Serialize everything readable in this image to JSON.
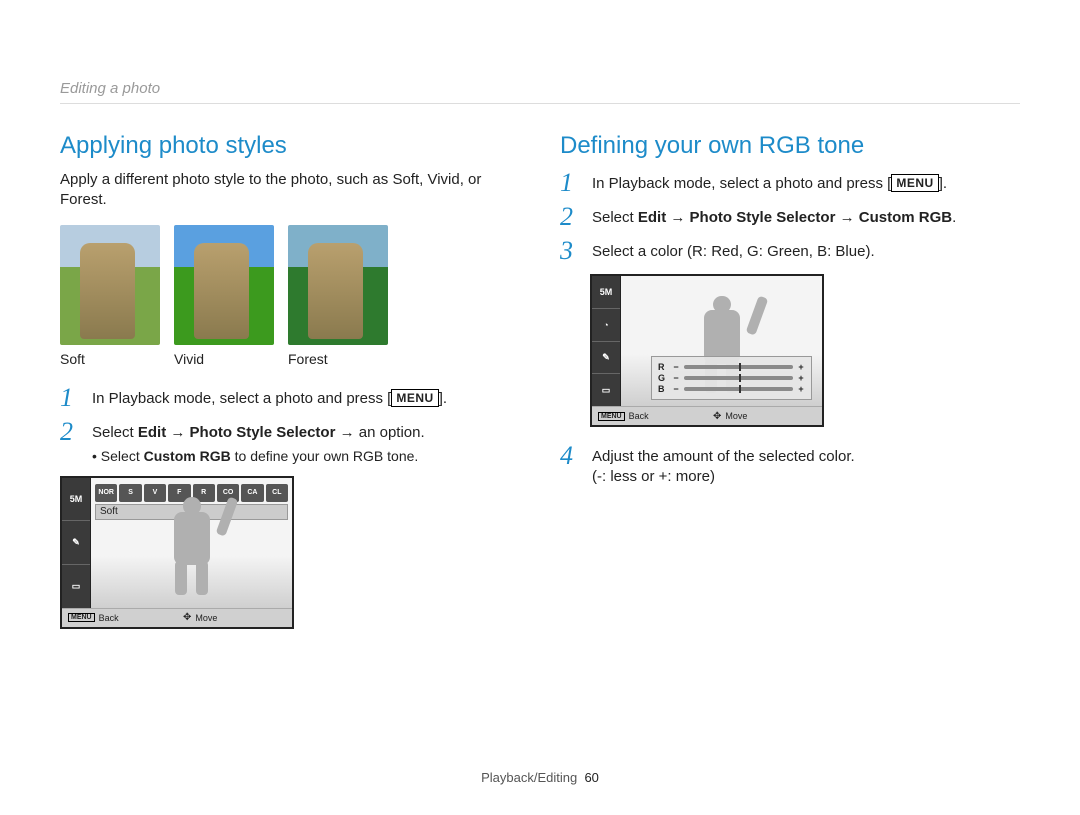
{
  "breadcrumb": "Editing a photo",
  "left": {
    "heading": "Applying photo styles",
    "intro": "Apply a different photo style to the photo, such as Soft, Vivid, or Forest.",
    "thumbs": [
      "Soft",
      "Vivid",
      "Forest"
    ],
    "steps": [
      {
        "num": "1",
        "text_a": "In Playback mode, select a photo and press [",
        "text_b": "].",
        "menu": "MENU"
      },
      {
        "num": "2",
        "text_a": "Select ",
        "bold1": "Edit",
        "arrow1": " → ",
        "bold2": "Photo Style Selector",
        "arrow2": " → ",
        "text_b": "an option.",
        "sub_a": "Select ",
        "sub_bold": "Custom RGB",
        "sub_b": " to define your own RGB tone."
      }
    ],
    "lcd": {
      "side_icons": [
        "5M",
        "✎",
        "▭"
      ],
      "style_chips": [
        "NOR",
        "S",
        "V",
        "F",
        "R",
        "CO",
        "CA",
        "CL"
      ],
      "selected_style": "Soft",
      "footer_back_icon": "MENU",
      "footer_back": "Back",
      "footer_move_icon": "✥",
      "footer_move": "Move"
    }
  },
  "right": {
    "heading": "Defining your own RGB tone",
    "steps": [
      {
        "num": "1",
        "text_a": "In Playback mode, select a photo and press [",
        "text_b": "].",
        "menu": "MENU"
      },
      {
        "num": "2",
        "text_a": "Select ",
        "bold1": "Edit",
        "arrow1": " → ",
        "bold2": "Photo Style Selector",
        "arrow2": " → ",
        "bold3": "Custom RGB",
        "text_b": "."
      },
      {
        "num": "3",
        "text_a": "Select a color (R: Red, G: Green, B: Blue)."
      },
      {
        "num": "4",
        "text_a": "Adjust the amount of the selected color.",
        "line2": "(-: less or +: more)"
      }
    ],
    "lcd": {
      "side_icons": [
        "5M",
        "◔",
        "✎",
        "▭"
      ],
      "rgb": [
        {
          "label": "R",
          "minus": "−",
          "plus": "+"
        },
        {
          "label": "G",
          "minus": "−",
          "plus": "+"
        },
        {
          "label": "B",
          "minus": "−",
          "plus": "+"
        }
      ],
      "footer_back_icon": "MENU",
      "footer_back": "Back",
      "footer_move_icon": "✥",
      "footer_move": "Move"
    }
  },
  "footer": {
    "section": "Playback/Editing",
    "page": "60"
  }
}
